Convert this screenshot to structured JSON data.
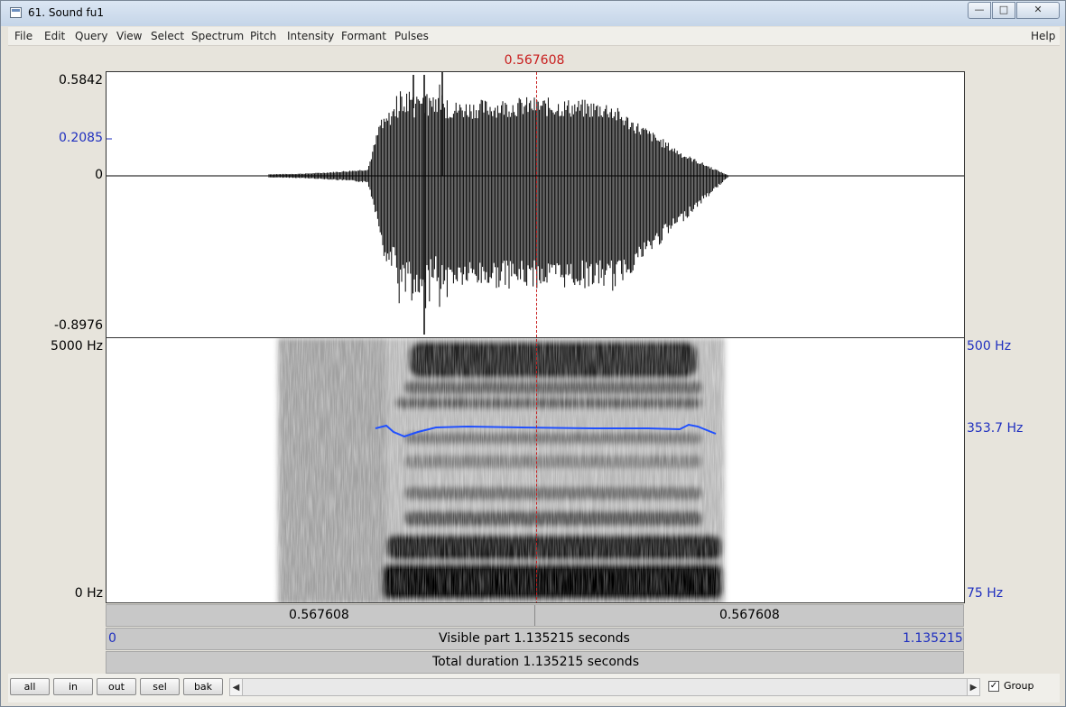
{
  "window": {
    "title": "61. Sound fu1"
  },
  "menu": [
    "File",
    "Edit",
    "Query",
    "View",
    "Select",
    "Spectrum",
    "Pitch",
    "Intensity",
    "Formant",
    "Pulses"
  ],
  "help_label": "Help",
  "cursor": {
    "time": "0.567608"
  },
  "waveform": {
    "y_max": "0.5842",
    "y_mark": "0.2085",
    "y_zero": "0",
    "y_min": "-0.8976"
  },
  "spectrogram": {
    "freq_max": "5000 Hz",
    "freq_min": "0 Hz"
  },
  "pitch": {
    "ceiling": "500 Hz",
    "cursor_value": "353.7 Hz",
    "floor": "75 Hz",
    "color": "#2050ff"
  },
  "time_bar": {
    "left_label": "0.567608",
    "right_label": "0.567608"
  },
  "visible_bar": {
    "start": "0",
    "label": "Visible part 1.135215 seconds",
    "end": "1.135215"
  },
  "total_bar": {
    "label": "Total duration 1.135215 seconds"
  },
  "buttons": {
    "all": "all",
    "in": "in",
    "out": "out",
    "sel": "sel",
    "bak": "bak"
  },
  "group": {
    "label": "Group",
    "checked": true
  }
}
